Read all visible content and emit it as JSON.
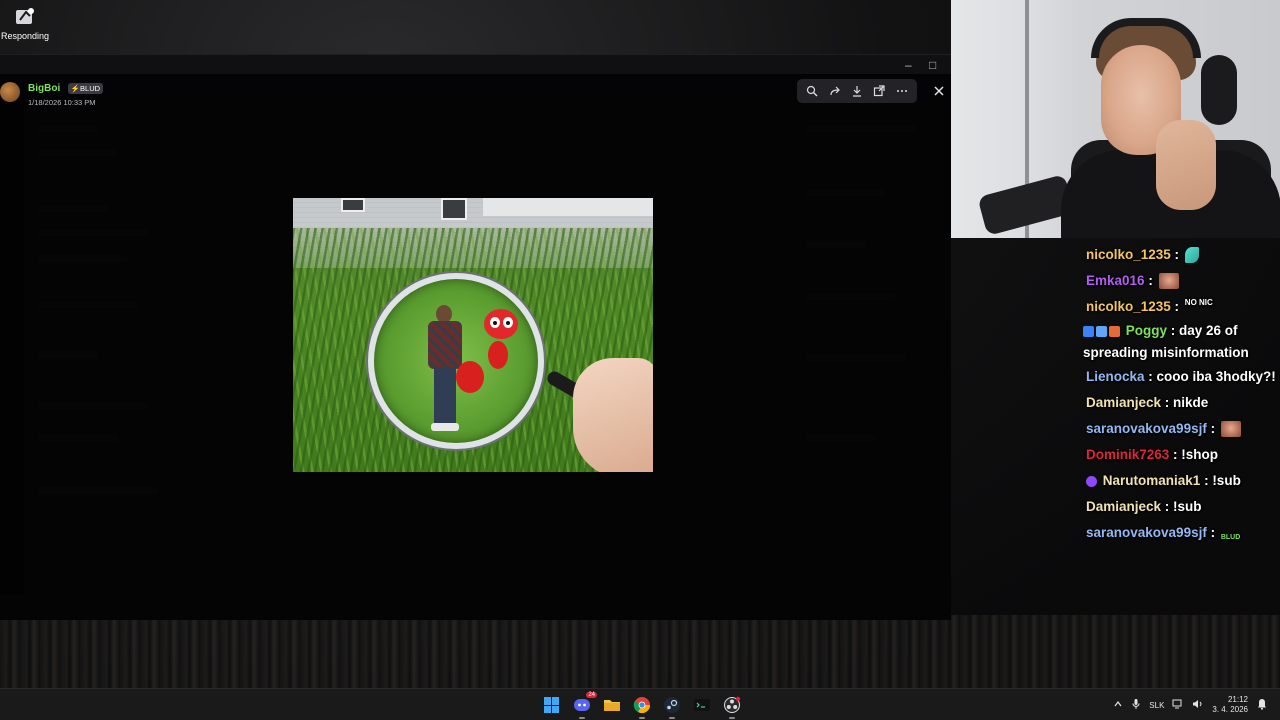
{
  "desktop": {
    "shortcut_label": "Responding"
  },
  "viewer": {
    "author": {
      "username": "BigBoi",
      "badge": "BLUD",
      "timestamp": "1/18/2026 10:33 PM"
    },
    "toolbar": {
      "icons": [
        "zoom-icon",
        "forward-icon",
        "download-icon",
        "open-external-icon",
        "more-icon"
      ],
      "close_icon": "close-icon"
    }
  },
  "chat": {
    "messages": [
      {
        "user": "nicolko_1235",
        "color": "#f5c65c",
        "text": "",
        "emote": "leaf"
      },
      {
        "user": "Emka016",
        "color": "#b35cf0",
        "text": "",
        "emote": "face"
      },
      {
        "user": "nicolko_1235",
        "color": "#f5c65c",
        "text": "",
        "emote": "nonic",
        "emote_text": "NO NIC"
      },
      {
        "user": "Poggy",
        "color": "#7ee25d",
        "text": "day 26 of spreading misinformation",
        "badges": true
      },
      {
        "user": "Lienocka",
        "color": "#93b8f2",
        "text": "cooo iba 3hodky?!"
      },
      {
        "user": "Damianjeck",
        "color": "#f2e2b2",
        "text": "nikde"
      },
      {
        "user": "saranovakova99sjf",
        "color": "#93b8f2",
        "text": "",
        "emote": "face"
      },
      {
        "user": "Dominik7263",
        "color": "#e0243a",
        "text": "!shop"
      },
      {
        "user": "Narutomaniak1",
        "color": "#f2e2b2",
        "text": "!sub",
        "badges": true
      },
      {
        "user": "Damianjeck",
        "color": "#f2e2b2",
        "text": "!sub"
      },
      {
        "user": "saranovakova99sjf",
        "color": "#93b8f2",
        "text": "",
        "emote": "blud",
        "emote_text": "BLUD"
      }
    ]
  },
  "taskbar": {
    "apps": [
      "windows-start-icon",
      "discord-icon",
      "file-explorer-icon",
      "chrome-icon",
      "steam-icon",
      "terminal-icon",
      "obs-icon"
    ],
    "discord_badge": "24",
    "tray": {
      "language": "SLK",
      "time": "21:12",
      "date": "3. 4. 2026"
    }
  }
}
